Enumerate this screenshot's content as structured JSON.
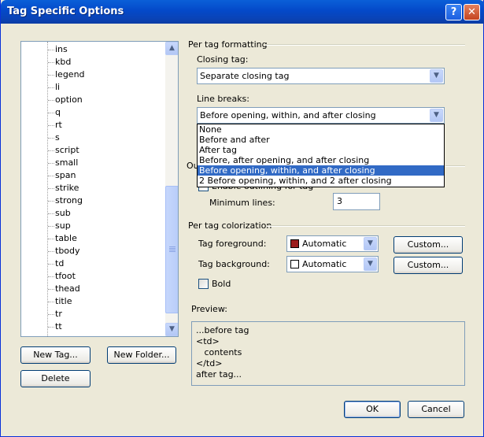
{
  "window": {
    "title": "Tag Specific Options"
  },
  "titlebar_buttons": {
    "help": "?",
    "close": "✕"
  },
  "tag_list": {
    "items": [
      "ins",
      "kbd",
      "legend",
      "li",
      "option",
      "q",
      "rt",
      "s",
      "script",
      "small",
      "span",
      "strike",
      "strong",
      "sub",
      "sup",
      "table",
      "tbody",
      "td",
      "tfoot",
      "thead",
      "title",
      "tr",
      "tt"
    ]
  },
  "left_buttons": {
    "new_tag": "New Tag...",
    "new_folder": "New Folder...",
    "delete": "Delete"
  },
  "per_tag_formatting": {
    "header": "Per tag formatting",
    "closing_tag_label": "Closing tag:",
    "closing_tag_value": "Separate closing tag",
    "line_breaks_label": "Line breaks:",
    "line_breaks_value": "Before opening, within, and after closing",
    "line_breaks_options": [
      "None",
      "Before and after",
      "After tag",
      "Before, after opening, and after closing",
      "Before opening, within, and after closing",
      "2 Before opening, within, and 2 after closing"
    ],
    "line_breaks_selected_index": 4
  },
  "outline": {
    "header_fragment": "Ou",
    "checkbox_fragment": "Enable outlining for tag",
    "minimum_lines_label": "Minimum lines:",
    "minimum_lines_value": "3"
  },
  "per_tag_colorization": {
    "header": "Per tag colorization",
    "fg_label": "Tag foreground:",
    "fg_value": "Automatic",
    "fg_color": "#9b1c1c",
    "bg_label": "Tag background:",
    "bg_value": "Automatic",
    "bg_color": "#ffffff",
    "custom_label": "Custom...",
    "bold_label": "Bold"
  },
  "preview": {
    "label": "Preview:",
    "lines": [
      "...before tag",
      "<td>",
      "   contents",
      "</td>",
      "after tag..."
    ]
  },
  "footer": {
    "ok": "OK",
    "cancel": "Cancel"
  }
}
